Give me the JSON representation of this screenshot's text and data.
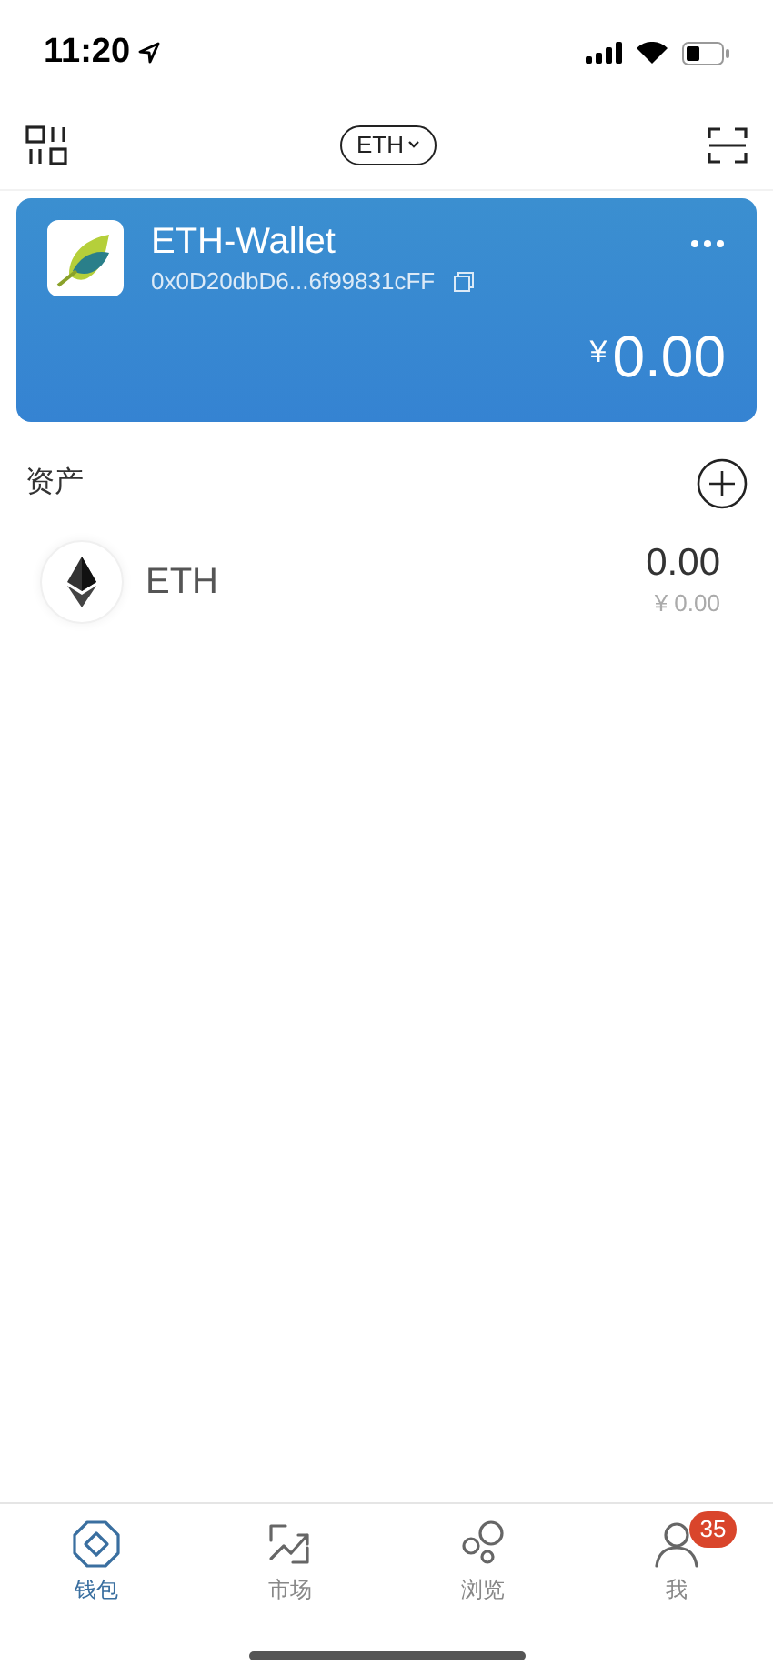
{
  "status_bar": {
    "time": "11:20"
  },
  "toolbar": {
    "network": "ETH"
  },
  "wallet_card": {
    "name": "ETH-Wallet",
    "address": "0x0D20dbD6...6f99831cFF",
    "currency": "¥",
    "balance": "0.00"
  },
  "assets": {
    "title": "资产",
    "items": [
      {
        "symbol": "ETH",
        "amount": "0.00",
        "value": "¥ 0.00"
      }
    ]
  },
  "tab_bar": [
    {
      "kind": "wallet",
      "label": "钱包",
      "selected": true
    },
    {
      "kind": "market",
      "label": "市场",
      "selected": false
    },
    {
      "kind": "browse",
      "label": "浏览",
      "selected": false
    },
    {
      "kind": "me",
      "label": "我",
      "selected": false,
      "badge": "35"
    }
  ]
}
